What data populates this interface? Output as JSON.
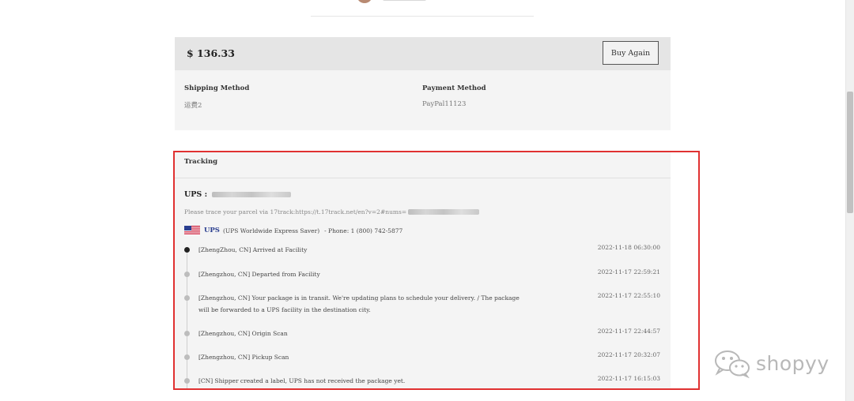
{
  "order": {
    "total": "$ 136.33",
    "buy_again_label": "Buy Again"
  },
  "shipping": {
    "label": "Shipping Method",
    "value": "运费2"
  },
  "payment": {
    "label": "Payment Method",
    "value": "PayPal11123"
  },
  "tracking": {
    "title": "Tracking",
    "carrier_prefix": "UPS :",
    "trace_note": "Please trace your parcel via 17track:https://t.17track.net/en?v=2#nums=",
    "carrier": {
      "code": "UPS",
      "name": "(UPS Worldwide Express Saver)",
      "phone": "-  Phone: 1 (800) 742-5877",
      "flag_icon": "us-flag-icon"
    },
    "events": [
      {
        "text": "[ZhengZhou, CN] Arrived at Facility",
        "time": "2022-11-18 06:30:00",
        "current": true
      },
      {
        "text": "[Zhengzhou, CN] Departed from Facility",
        "time": "2022-11-17 22:59:21",
        "current": false
      },
      {
        "text": "[Zhengzhou, CN] Your package is in transit. We're updating plans to schedule your delivery. / The package will be forwarded to a UPS facility in the destination city.",
        "time": "2022-11-17 22:55:10",
        "current": false
      },
      {
        "text": "[Zhengzhou, CN] Origin Scan",
        "time": "2022-11-17 22:44:57",
        "current": false
      },
      {
        "text": "[Zhengzhou, CN] Pickup Scan",
        "time": "2022-11-17 20:32:07",
        "current": false
      },
      {
        "text": "[CN] Shipper created a label, UPS has not received the package yet.",
        "time": "2022-11-17 16:15:03",
        "current": false
      }
    ]
  },
  "watermark": {
    "text": "shopyy",
    "icon": "wechat-icon"
  },
  "colors": {
    "highlight": "#e03131",
    "carrier_blue": "#2a3e8f"
  }
}
